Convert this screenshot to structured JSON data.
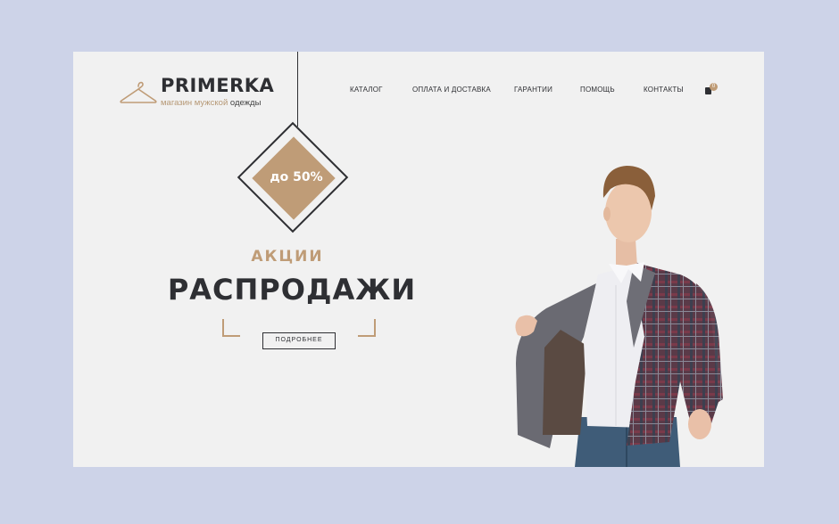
{
  "header": {
    "brand": "PRIMERKA",
    "tagline_part1": "магазин мужской",
    "tagline_part2": "одежды"
  },
  "nav": {
    "items": [
      {
        "label": "КАТАЛОГ"
      },
      {
        "label": "ОПЛАТА И ДОСТАВКА"
      },
      {
        "label": "ГАРАНТИИ"
      },
      {
        "label": "ПОМОЩЬ"
      },
      {
        "label": "КОНТАКТЫ"
      }
    ],
    "cart_count": "0"
  },
  "hero": {
    "badge": "до 50%",
    "subtitle": "АКЦИИ",
    "title": "РАСПРОДАЖИ",
    "button": "ПОДРОБНЕЕ"
  },
  "colors": {
    "accent": "#bf9c77",
    "text": "#2e2f33",
    "page_bg": "#f1f1f1",
    "outer_bg": "#cdd3e8"
  },
  "icons": [
    "hanger-icon",
    "cart-icon"
  ]
}
